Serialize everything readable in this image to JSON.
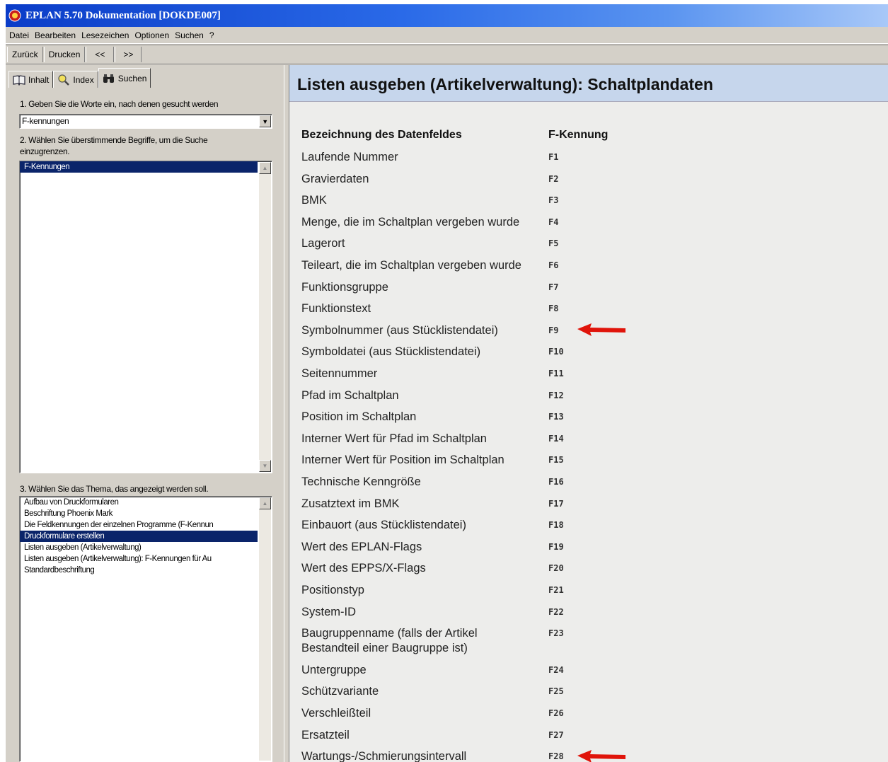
{
  "window": {
    "title": "EPLAN 5.70  Dokumentation  [DOKDE007]"
  },
  "menu": [
    "Datei",
    "Bearbeiten",
    "Lesezeichen",
    "Optionen",
    "Suchen",
    "?"
  ],
  "toolbar": {
    "back": "Zurück",
    "print": "Drucken",
    "prev": "<<",
    "next": ">>"
  },
  "tabs": {
    "contents": "Inhalt",
    "index": "Index",
    "search": "Suchen"
  },
  "search": {
    "step1": "1. Geben Sie die Worte ein, nach denen gesucht werden",
    "query": "F-kennungen",
    "step2_line1": "2. Wählen Sie überstimmende Begriffe, um die Suche",
    "step2_line2": "einzugrenzen.",
    "matches": [
      "F-Kennungen"
    ],
    "step3": "3. Wählen Sie das Thema, das angezeigt werden soll.",
    "topics": [
      "Aufbau von Druckformularen",
      "Beschriftung Phoenix Mark",
      "Die Feldkennungen der einzelnen Programme (F-Kennun",
      "Druckformulare erstellen",
      "Listen ausgeben (Artikelverwaltung)",
      "Listen ausgeben (Artikelverwaltung): F-Kennungen für Au",
      "Standardbeschriftung"
    ],
    "selected_topic_index": 3
  },
  "topic": {
    "title": "Listen ausgeben (Artikelverwaltung): Schaltplandaten",
    "col_name": "Bezeichnung des Datenfeldes",
    "col_code": "F-Kennung",
    "rows": [
      {
        "name": "Laufende Nummer",
        "code": "F1"
      },
      {
        "name": "Gravierdaten",
        "code": "F2"
      },
      {
        "name": "BMK",
        "code": "F3"
      },
      {
        "name": "Menge, die im Schaltplan vergeben wurde",
        "code": "F4"
      },
      {
        "name": "Lagerort",
        "code": "F5"
      },
      {
        "name": "Teileart, die im Schaltplan vergeben wurde",
        "code": "F6"
      },
      {
        "name": "Funktionsgruppe",
        "code": "F7"
      },
      {
        "name": "Funktionstext",
        "code": "F8"
      },
      {
        "name": "Symbolnummer (aus Stücklistendatei)",
        "code": "F9"
      },
      {
        "name": "Symboldatei (aus Stücklistendatei)",
        "code": "F10"
      },
      {
        "name": "Seitennummer",
        "code": "F11"
      },
      {
        "name": "Pfad im Schaltplan",
        "code": "F12"
      },
      {
        "name": "Position im Schaltplan",
        "code": "F13"
      },
      {
        "name": "Interner Wert für Pfad im Schaltplan",
        "code": "F14"
      },
      {
        "name": "Interner Wert für Position im Schaltplan",
        "code": "F15"
      },
      {
        "name": "Technische Kenngröße",
        "code": "F16"
      },
      {
        "name": "Zusatztext im BMK",
        "code": "F17"
      },
      {
        "name": "Einbauort (aus Stücklistendatei)",
        "code": "F18"
      },
      {
        "name": "Wert des EPLAN-Flags",
        "code": "F19"
      },
      {
        "name": "Wert des EPPS/X-Flags",
        "code": "F20"
      },
      {
        "name": "Positionstyp",
        "code": "F21"
      },
      {
        "name": "System-ID",
        "code": "F22"
      },
      {
        "name": "Baugruppenname (falls der Artikel",
        "name2": "Bestandteil einer Baugruppe ist)",
        "code": "F23"
      },
      {
        "name": "Untergruppe",
        "code": "F24"
      },
      {
        "name": "Schützvariante",
        "code": "F25"
      },
      {
        "name": "Verschleißteil",
        "code": "F26"
      },
      {
        "name": "Ersatzteil",
        "code": "F27"
      },
      {
        "name": "Wartungs-/Schmierungsintervall",
        "code": "F28"
      }
    ]
  },
  "icons": {
    "app": "eplan-app-icon",
    "contents": "book-icon",
    "index": "magnifier-icon",
    "search": "binoculars-icon",
    "annotation": "red-arrow-icon"
  },
  "colors": {
    "title_gradient_start": "#0a3cc8",
    "selection": "#0a246a",
    "topic_header": "#c6d6ec",
    "arrow": "#e0140a"
  }
}
